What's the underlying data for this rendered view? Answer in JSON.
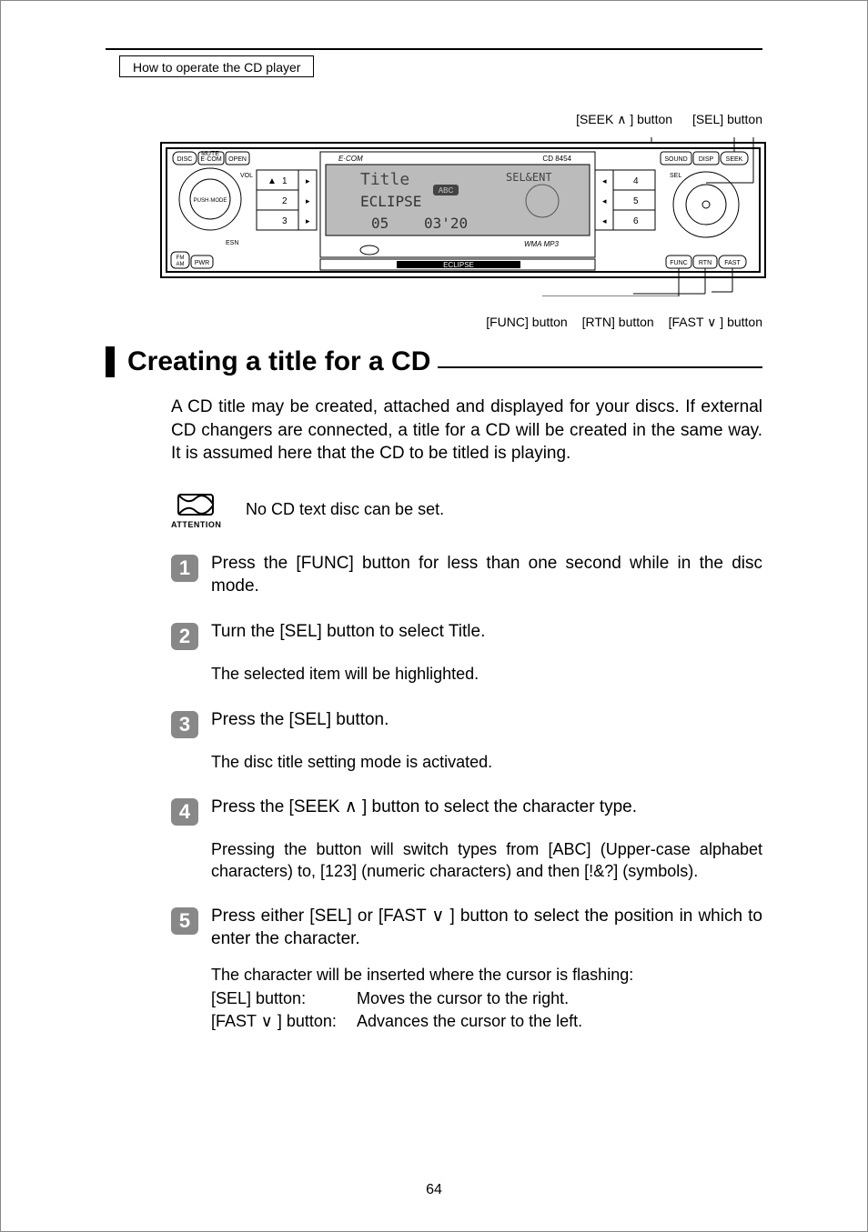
{
  "header": {
    "breadcrumb": "How to operate the CD player"
  },
  "figure": {
    "top_labels": {
      "seek": "[SEEK ∧ ] button",
      "sel": "[SEL] button"
    },
    "bottom_labels": {
      "func": "[FUNC] button",
      "rtn": "[RTN] button",
      "fast": "[FAST ∨ ] button"
    },
    "faceplate": {
      "mute": "MUTE",
      "disc": "DISC",
      "ecom_btn": "E·COM",
      "open": "OPEN",
      "vol": "VOL",
      "push": "PUSH·MODE",
      "esn": "ESN",
      "fmam": "FM\nAM",
      "pwr": "PWR",
      "ecom_logo": "E·COM",
      "model": "CD 8454",
      "lcd_title": "Title",
      "lcd_src": "SEL&ENT",
      "lcd_badge": "ABC",
      "lcd_line2": "ECLIPSE",
      "lcd_track": "05",
      "lcd_time": "03'20",
      "wma_mp3": "WMA MP3",
      "brand_under": "ECLIPSE",
      "presets_left": [
        "1",
        "2",
        "3"
      ],
      "presets_right": [
        "4",
        "5",
        "6"
      ],
      "sound": "SOUND",
      "disp": "DISP",
      "seek": "SEEK",
      "sel_ring": "SEL",
      "func": "FUNC",
      "rtn": "RTN",
      "fast": "FAST"
    }
  },
  "heading": "Creating a title for a CD",
  "intro": "A CD title may be created, attached and displayed for your discs. If external CD changers are connected, a title for a CD will be created in the same way. It is assumed here that the CD to be titled is playing.",
  "attention": {
    "label": "ATTENTION",
    "text": "No CD text disc can be set."
  },
  "steps": [
    {
      "n": "1",
      "body": "Press the [FUNC] button for less than one second while in the disc mode."
    },
    {
      "n": "2",
      "body": "Turn the [SEL] button to select Title.",
      "sub": "The selected item will be highlighted."
    },
    {
      "n": "3",
      "body": "Press the [SEL] button.",
      "sub": "The disc title setting mode is activated."
    },
    {
      "n": "4",
      "body": "Press the [SEEK ∧ ] button to select the character type.",
      "sub": "Pressing the button will switch types from [ABC] (Upper-case alphabet characters) to, [123] (numeric characters) and then [!&?] (symbols)."
    },
    {
      "n": "5",
      "body": "Press either [SEL] or [FAST ∨ ] button to select the position in which to enter the character.",
      "sub": "The character will be inserted where the cursor is flashing:",
      "defs": [
        {
          "label": "[SEL] button:",
          "text": "Moves the cursor to the right."
        },
        {
          "label": "[FAST ∨ ] button:",
          "text": "Advances the cursor to the left."
        }
      ]
    }
  ],
  "page_number": "64"
}
